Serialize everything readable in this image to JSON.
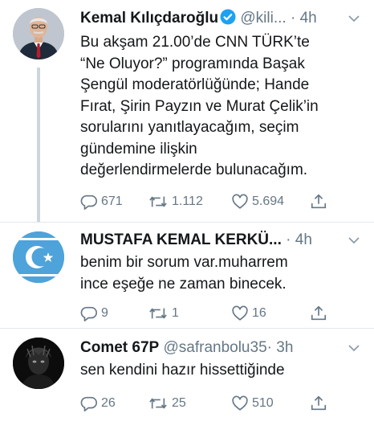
{
  "tweets": [
    {
      "name": "Kemal Kılıçdaroğlu",
      "handle": "@kili...",
      "dot": "·",
      "time": "4h",
      "verified": true,
      "text_lines": [
        "Bu akşam 21.00’de CNN TÜRK’te",
        "“Ne Oluyor?” programında Başak",
        "Şengül moderatörlüğünde; Hande",
        "Fırat, Şirin Payzın ve Murat Çelik’in",
        "sorularını yanıtlayacağım, seçim",
        "gündemine ilişkin",
        "değerlendirmelerde bulunacağım."
      ],
      "replies": "671",
      "retweets": "1.112",
      "likes": "5.694"
    },
    {
      "name": "MUSTAFA KEMAL KERKÜ...",
      "handle": "",
      "dot": "·",
      "time": "4h",
      "verified": false,
      "text_lines": [
        "benim bir sorum var.muharrem",
        "ince eşeğe ne zaman binecek."
      ],
      "replies": "9",
      "retweets": "1",
      "likes": "16"
    },
    {
      "name": "Comet 67P",
      "handle": "@safranbolu35",
      "dot": "·",
      "time": "3h",
      "verified": false,
      "text_lines": [
        "sen kendini hazır hissettiğinde"
      ],
      "replies": "26",
      "retweets": "25",
      "likes": "510"
    }
  ],
  "colors": {
    "text": "#14171a",
    "secondary": "#657786",
    "verified": "#1da1f2",
    "thread_line": "#ccd6dd",
    "separator": "#e1e8ed",
    "flag_blue": "#4ea3da"
  },
  "icons": [
    "verified-badge-icon",
    "chevron-down-icon",
    "reply-icon",
    "retweet-icon",
    "like-icon",
    "share-icon"
  ]
}
